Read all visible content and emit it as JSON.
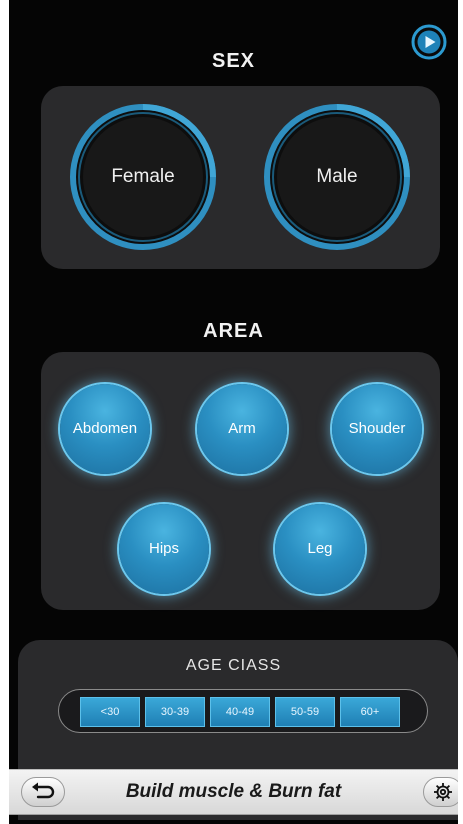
{
  "colors": {
    "background": "#050505",
    "panel": "#2a2a2c",
    "accent": "#2a8fc2",
    "ring": "#2f8fc0"
  },
  "header": {
    "play_icon": "play-icon"
  },
  "sex": {
    "title": "SEX",
    "options": [
      {
        "label": "Female"
      },
      {
        "label": "Male"
      }
    ]
  },
  "area": {
    "title": "AREA",
    "options": [
      {
        "label": "Abdomen"
      },
      {
        "label": "Arm"
      },
      {
        "label": "Shouder"
      },
      {
        "label": "Hips"
      },
      {
        "label": "Leg"
      }
    ]
  },
  "age": {
    "title": "AGE CIASS",
    "options": [
      {
        "label": "<30"
      },
      {
        "label": "30-39"
      },
      {
        "label": "40-49"
      },
      {
        "label": "50-59"
      },
      {
        "label": "60+"
      }
    ]
  },
  "bottom_bar": {
    "title": "Build muscle & Burn fat",
    "back_icon": "back-arrow-icon",
    "settings_icon": "gear-icon"
  }
}
